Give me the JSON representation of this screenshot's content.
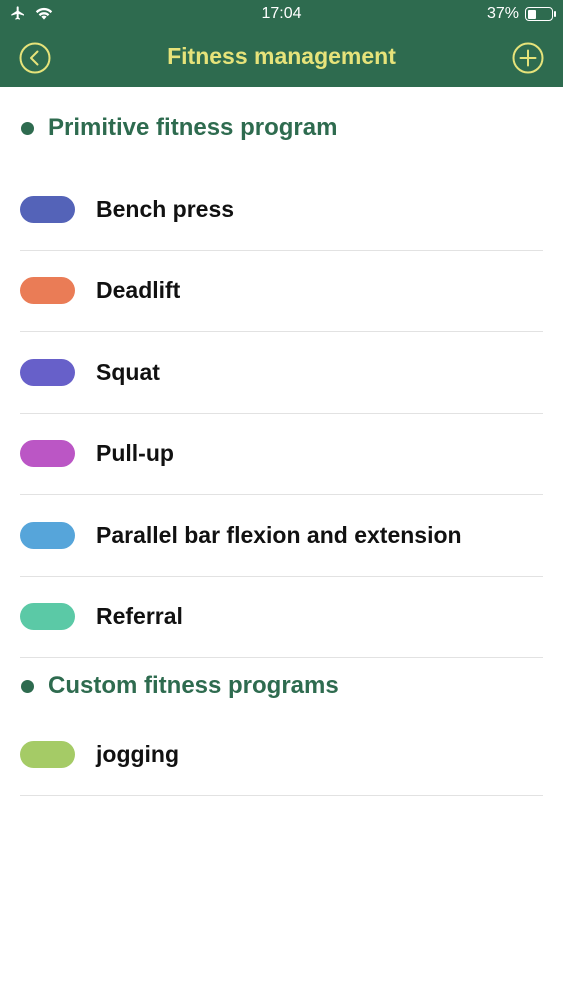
{
  "status": {
    "time": "17:04",
    "battery_text": "37%",
    "battery_level": 0.37
  },
  "header": {
    "title": "Fitness management",
    "bg_color": "#2e6b4f",
    "title_color": "#e6e37a"
  },
  "sections": [
    {
      "title": "Primitive fitness program",
      "items": [
        {
          "label": "Bench press",
          "color": "#5463b8"
        },
        {
          "label": "Deadlift",
          "color": "#ea7c56"
        },
        {
          "label": "Squat",
          "color": "#6760c9"
        },
        {
          "label": "Pull-up",
          "color": "#bb56c5"
        },
        {
          "label": "Parallel bar flexion and extension",
          "color": "#56a5da"
        },
        {
          "label": "Referral",
          "color": "#5bc9a6"
        }
      ]
    },
    {
      "title": "Custom fitness programs",
      "items": [
        {
          "label": "jogging",
          "color": "#a5cb66"
        }
      ]
    }
  ]
}
